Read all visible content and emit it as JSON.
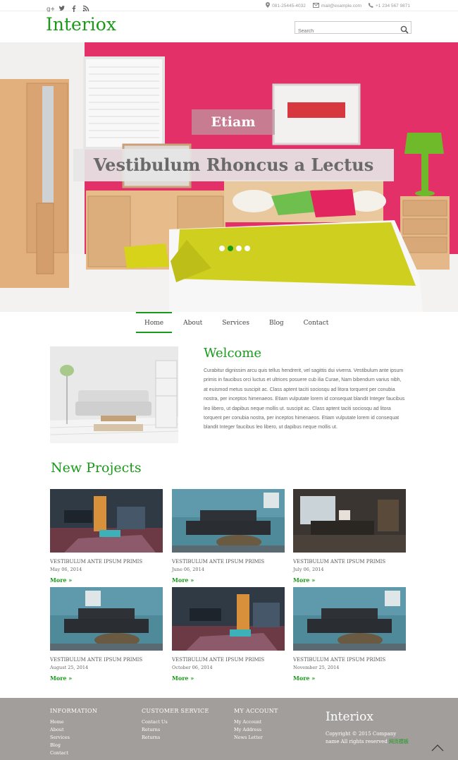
{
  "topbar": {
    "social": [
      "google-plus-icon",
      "twitter-icon",
      "facebook-icon",
      "rss-icon"
    ],
    "phone": "081-25445-4032",
    "email": "mail@example.com",
    "alt_phone": "+1 234 567 9871"
  },
  "header": {
    "logo": "Interiox",
    "search_placeholder": "Search"
  },
  "hero": {
    "badge": "Etiam",
    "headline": "Vestibulum Rhoncus a Lectus",
    "slides": 4,
    "active_slide": 2
  },
  "nav": {
    "items": [
      "Home",
      "About",
      "Services",
      "Blog",
      "Contact"
    ],
    "active": "Home"
  },
  "welcome": {
    "title": "Welcome",
    "text": "Curabitur dignissim arcu quis tellus hendrerit, vel sagittis dui viverra. Vestibulum ante ipsum primis in faucibus orci luctus et ultrices posuere cub ilia Curae, Nam bibendum varius nibh, at euismod metus suscipit ac. Class aptent taciti sociosqu ad litora torquent per conubia nostra, per inceptos himenaeos. Etiam vulputate lorem id consequat blandit Integer faucibus leo libero, ut dapibus neque mollis ut. suscipit ac. Class aptent taciti sociosqu ad litora torquent per conubia nostra, per inceptos himenaeos. Etiam vulputate lorem id consequat blandit Integer faucibus leo libero, ut dapibus neque mollis ut."
  },
  "projects": {
    "title": "New Projects",
    "items": [
      {
        "caption": "VESTIBULUM ANTE IPSUM PRIMIS",
        "date": "May 06, 2014",
        "more": "More »"
      },
      {
        "caption": "VESTIBULUM ANTE IPSUM PRIMIS",
        "date": "June 06, 2014",
        "more": "More »"
      },
      {
        "caption": "VESTIBULUM ANTE IPSUM PRIMIS",
        "date": "July 06, 2014",
        "more": "More »"
      },
      {
        "caption": "VESTIBULUM ANTE IPSUM PRIMIS",
        "date": "August 25, 2014",
        "more": "More »"
      },
      {
        "caption": "VESTIBULUM ANTE IPSUM PRIMIS",
        "date": "October 06, 2014",
        "more": "More »"
      },
      {
        "caption": "VESTIBULUM ANTE IPSUM PRIMIS",
        "date": "November 25, 2014",
        "more": "More »"
      }
    ]
  },
  "footer": {
    "information": {
      "title": "INFORMATION",
      "links": [
        "Home",
        "About",
        "Services",
        "Blog",
        "Contact"
      ]
    },
    "customer_service": {
      "title": "CUSTOMER SERVICE",
      "links": [
        "Contact Us",
        "Returns",
        "Returns"
      ]
    },
    "my_account": {
      "title": "MY ACCOUNT",
      "links": [
        "My Account",
        "My Address",
        "News Letter"
      ]
    },
    "logo": "Interiox",
    "copyright": "Copyright © 2015 Company name All rights reserved",
    "copyright_highlight": "网页模板"
  },
  "colors": {
    "accent": "#1a9a1a",
    "footer_bg": "#a29e9c",
    "hero_wall": "#e8326a"
  }
}
